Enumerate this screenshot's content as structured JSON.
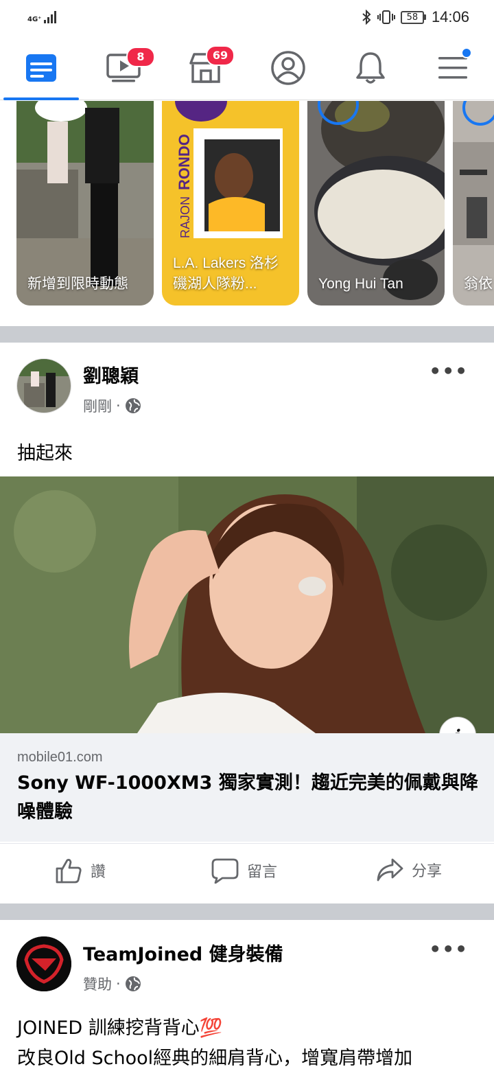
{
  "status_bar": {
    "network": "4G⁺",
    "battery": "58",
    "time": "14:06"
  },
  "nav": {
    "video_badge": "8",
    "marketplace_badge": "69"
  },
  "stories": [
    {
      "label": "新增到限時動態"
    },
    {
      "label": "L.A. Lakers 洛杉磯湖人隊粉..."
    },
    {
      "label": "Yong Hui Tan"
    },
    {
      "label": "翁依"
    }
  ],
  "post1": {
    "author": "劉聰穎",
    "time": "剛剛",
    "text": "抽起來",
    "link_domain": "mobile01.com",
    "link_title": "Sony WF-1000XM3 獨家實測！趨近完美的佩戴與降噪體驗",
    "info_label": "i"
  },
  "actions": {
    "like": "讚",
    "comment": "留言",
    "share": "分享"
  },
  "post2": {
    "author": "TeamJoined 健身裝備",
    "meta": "贊助",
    "line1": "JOINED 訓練挖背背心💯",
    "line2": "改良Old School經典的細肩背心，增寬肩帶增加"
  },
  "colors": {
    "accent": "#1877f2",
    "badge": "#f02849",
    "divider": "#c9ccd1"
  }
}
